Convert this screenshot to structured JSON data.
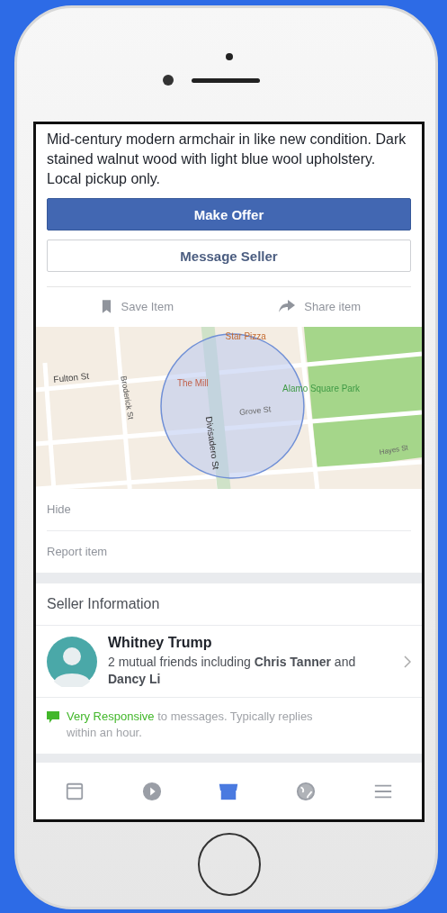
{
  "listing": {
    "description": "Mid-century modern armchair in like new condition. Dark stained walnut wood with light blue wool upholstery. Local pickup only."
  },
  "buttons": [
    {
      "label": "Make Offer",
      "kind": "primary"
    },
    {
      "label": "Message Seller",
      "kind": "secondary"
    }
  ],
  "actions": [
    {
      "label": "Save Item",
      "kind": "bookmark"
    },
    {
      "label": "Share item",
      "kind": "share"
    }
  ],
  "map": {
    "labels": [
      "Star Pizza",
      "Fulton St",
      "Broderick St",
      "The Mill",
      "Alamo Square Park",
      "Grove St",
      "Divisadero St",
      "Hayes St"
    ]
  },
  "options": [
    "Hide",
    "Report item"
  ],
  "seller": {
    "heading": "Seller Information",
    "name": "Whitney Trump",
    "mutual": "2 mutual friends including **Chris Tanner** and **Dancy Li**",
    "responsive_highlight": "Very Responsive",
    "responsive_rest": "to messages. Typically replies within an hour."
  },
  "tabs": [
    {
      "kind": "news",
      "selected": false
    },
    {
      "kind": "video",
      "selected": false
    },
    {
      "kind": "marketplace",
      "selected": true
    },
    {
      "kind": "globe",
      "selected": false
    },
    {
      "kind": "menu",
      "selected": false
    }
  ]
}
